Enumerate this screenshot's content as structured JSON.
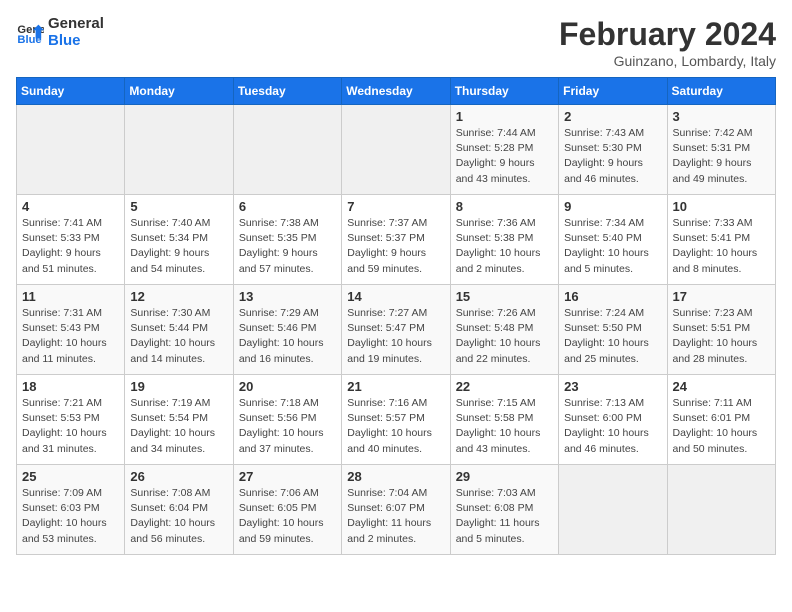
{
  "logo": {
    "line1": "General",
    "line2": "Blue"
  },
  "title": "February 2024",
  "subtitle": "Guinzano, Lombardy, Italy",
  "header": {
    "days": [
      "Sunday",
      "Monday",
      "Tuesday",
      "Wednesday",
      "Thursday",
      "Friday",
      "Saturday"
    ]
  },
  "weeks": [
    [
      {
        "day": "",
        "info": ""
      },
      {
        "day": "",
        "info": ""
      },
      {
        "day": "",
        "info": ""
      },
      {
        "day": "",
        "info": ""
      },
      {
        "day": "1",
        "info": "Sunrise: 7:44 AM\nSunset: 5:28 PM\nDaylight: 9 hours\nand 43 minutes."
      },
      {
        "day": "2",
        "info": "Sunrise: 7:43 AM\nSunset: 5:30 PM\nDaylight: 9 hours\nand 46 minutes."
      },
      {
        "day": "3",
        "info": "Sunrise: 7:42 AM\nSunset: 5:31 PM\nDaylight: 9 hours\nand 49 minutes."
      }
    ],
    [
      {
        "day": "4",
        "info": "Sunrise: 7:41 AM\nSunset: 5:33 PM\nDaylight: 9 hours\nand 51 minutes."
      },
      {
        "day": "5",
        "info": "Sunrise: 7:40 AM\nSunset: 5:34 PM\nDaylight: 9 hours\nand 54 minutes."
      },
      {
        "day": "6",
        "info": "Sunrise: 7:38 AM\nSunset: 5:35 PM\nDaylight: 9 hours\nand 57 minutes."
      },
      {
        "day": "7",
        "info": "Sunrise: 7:37 AM\nSunset: 5:37 PM\nDaylight: 9 hours\nand 59 minutes."
      },
      {
        "day": "8",
        "info": "Sunrise: 7:36 AM\nSunset: 5:38 PM\nDaylight: 10 hours\nand 2 minutes."
      },
      {
        "day": "9",
        "info": "Sunrise: 7:34 AM\nSunset: 5:40 PM\nDaylight: 10 hours\nand 5 minutes."
      },
      {
        "day": "10",
        "info": "Sunrise: 7:33 AM\nSunset: 5:41 PM\nDaylight: 10 hours\nand 8 minutes."
      }
    ],
    [
      {
        "day": "11",
        "info": "Sunrise: 7:31 AM\nSunset: 5:43 PM\nDaylight: 10 hours\nand 11 minutes."
      },
      {
        "day": "12",
        "info": "Sunrise: 7:30 AM\nSunset: 5:44 PM\nDaylight: 10 hours\nand 14 minutes."
      },
      {
        "day": "13",
        "info": "Sunrise: 7:29 AM\nSunset: 5:46 PM\nDaylight: 10 hours\nand 16 minutes."
      },
      {
        "day": "14",
        "info": "Sunrise: 7:27 AM\nSunset: 5:47 PM\nDaylight: 10 hours\nand 19 minutes."
      },
      {
        "day": "15",
        "info": "Sunrise: 7:26 AM\nSunset: 5:48 PM\nDaylight: 10 hours\nand 22 minutes."
      },
      {
        "day": "16",
        "info": "Sunrise: 7:24 AM\nSunset: 5:50 PM\nDaylight: 10 hours\nand 25 minutes."
      },
      {
        "day": "17",
        "info": "Sunrise: 7:23 AM\nSunset: 5:51 PM\nDaylight: 10 hours\nand 28 minutes."
      }
    ],
    [
      {
        "day": "18",
        "info": "Sunrise: 7:21 AM\nSunset: 5:53 PM\nDaylight: 10 hours\nand 31 minutes."
      },
      {
        "day": "19",
        "info": "Sunrise: 7:19 AM\nSunset: 5:54 PM\nDaylight: 10 hours\nand 34 minutes."
      },
      {
        "day": "20",
        "info": "Sunrise: 7:18 AM\nSunset: 5:56 PM\nDaylight: 10 hours\nand 37 minutes."
      },
      {
        "day": "21",
        "info": "Sunrise: 7:16 AM\nSunset: 5:57 PM\nDaylight: 10 hours\nand 40 minutes."
      },
      {
        "day": "22",
        "info": "Sunrise: 7:15 AM\nSunset: 5:58 PM\nDaylight: 10 hours\nand 43 minutes."
      },
      {
        "day": "23",
        "info": "Sunrise: 7:13 AM\nSunset: 6:00 PM\nDaylight: 10 hours\nand 46 minutes."
      },
      {
        "day": "24",
        "info": "Sunrise: 7:11 AM\nSunset: 6:01 PM\nDaylight: 10 hours\nand 50 minutes."
      }
    ],
    [
      {
        "day": "25",
        "info": "Sunrise: 7:09 AM\nSunset: 6:03 PM\nDaylight: 10 hours\nand 53 minutes."
      },
      {
        "day": "26",
        "info": "Sunrise: 7:08 AM\nSunset: 6:04 PM\nDaylight: 10 hours\nand 56 minutes."
      },
      {
        "day": "27",
        "info": "Sunrise: 7:06 AM\nSunset: 6:05 PM\nDaylight: 10 hours\nand 59 minutes."
      },
      {
        "day": "28",
        "info": "Sunrise: 7:04 AM\nSunset: 6:07 PM\nDaylight: 11 hours\nand 2 minutes."
      },
      {
        "day": "29",
        "info": "Sunrise: 7:03 AM\nSunset: 6:08 PM\nDaylight: 11 hours\nand 5 minutes."
      },
      {
        "day": "",
        "info": ""
      },
      {
        "day": "",
        "info": ""
      }
    ]
  ]
}
